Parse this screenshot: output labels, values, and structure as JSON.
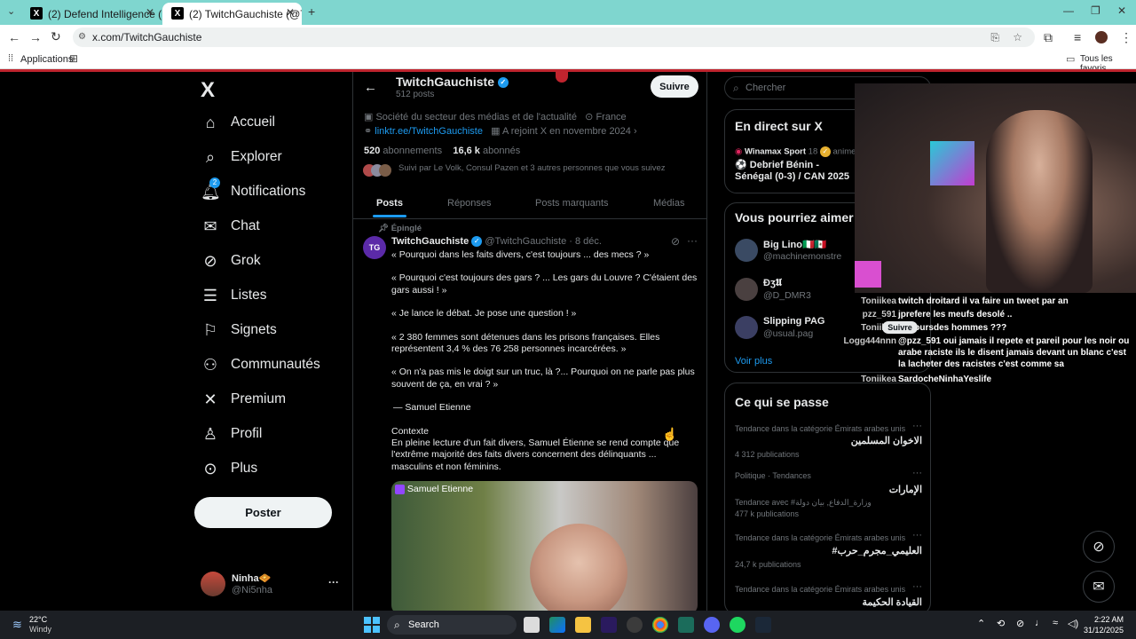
{
  "browser": {
    "tabs": [
      {
        "title": "(2) Defend Intelligence (Anis Ay",
        "favicon": "X"
      },
      {
        "title": "(2) TwitchGauchiste (@TwitchG",
        "favicon": "X"
      }
    ],
    "new_tab": "+",
    "url": "x.com/TwitchGauchiste",
    "bookmarks_apps": "Applications",
    "bookmarks_all": "Tous les favoris"
  },
  "nav": {
    "logo": "X",
    "items": [
      {
        "label": "Accueil",
        "icon": "home-icon"
      },
      {
        "label": "Explorer",
        "icon": "search-icon"
      },
      {
        "label": "Notifications",
        "icon": "bell-icon",
        "badge": "2"
      },
      {
        "label": "Chat",
        "icon": "mail-icon"
      },
      {
        "label": "Grok",
        "icon": "grok-icon"
      },
      {
        "label": "Listes",
        "icon": "list-icon"
      },
      {
        "label": "Signets",
        "icon": "bookmark-icon"
      },
      {
        "label": "Communautés",
        "icon": "people-icon"
      },
      {
        "label": "Premium",
        "icon": "x-icon"
      },
      {
        "label": "Profil",
        "icon": "user-icon"
      },
      {
        "label": "Plus",
        "icon": "more-icon"
      }
    ],
    "post_button": "Poster",
    "account": {
      "name": "Ninha🧇",
      "handle": "@Ni5nha",
      "more": "···"
    }
  },
  "profile": {
    "name": "TwitchGauchiste",
    "posts_count": "512 posts",
    "follow_button": "Suivre",
    "category": "Société du secteur des médias et de l'actualité",
    "location": "France",
    "link": "linktr.ee/TwitchGauchiste",
    "joined": "A rejoint X en novembre 2024",
    "following_count": "520",
    "following_label": "abonnements",
    "followers_count": "16,6 k",
    "followers_label": "abonnés",
    "followed_by": "Suivi par Le Volk, Consul Pazen et 3 autres personnes que vous suivez",
    "tabs": [
      "Posts",
      "Réponses",
      "Posts marquants",
      "Médias"
    ]
  },
  "post": {
    "pinned": "Épinglé",
    "author": "TwitchGauchiste",
    "handle": "@TwitchGauchiste",
    "date": "· 8 déc.",
    "avatar_text": "TG",
    "paragraphs": [
      "« Pourquoi dans les faits divers, c'est toujours ... des mecs ? »",
      "« Pourquoi c'est toujours des gars ? ... Les gars du Louvre ? C'étaient des gars aussi ! »",
      "« Je lance le débat. Je pose une question ! »",
      "« 2 380 femmes sont détenues dans les prisons françaises. Elles représentent 3,4 % des 76 258 personnes incarcérées. »",
      "« On n'a pas mis le doigt sur un truc, là ?... Pourquoi on ne parle pas plus souvent de ça, en vrai ? »",
      "— Samuel Etienne",
      "Contexte",
      "En pleine lecture d'un fait divers, Samuel Étienne se rend compte que l'extrême majorité des faits divers concernent des délinquants ... masculins et non féminins."
    ],
    "video_label": "Samuel Etienne"
  },
  "right": {
    "search_placeholder": "Chercher",
    "live": {
      "title": "En direct sur X",
      "host": "Winamax Sport",
      "host_suffix": "18",
      "host_action": "anime.",
      "event": "⚽ Debrief Bénin - Sénégal (0-3) / CAN 2025"
    },
    "suggest": {
      "title": "Vous pourriez aimer",
      "users": [
        {
          "name": "Big Lino🇮🇹🇲🇽",
          "handle": "@machinemonstre"
        },
        {
          "name": "Ɖʒ𝖀",
          "handle": "@D_DMR3"
        },
        {
          "name": "Slipping PAG",
          "handle": "@usual.pag"
        }
      ],
      "more": "Voir plus"
    },
    "trends": {
      "title": "Ce qui se passe",
      "items": [
        {
          "context": "Tendance dans la catégorie Émirats arabes unis",
          "name": "الاخوان المسلمين",
          "count": "4 312 publications"
        },
        {
          "context": "Politique · Tendances",
          "name": "الإمارات",
          "extra": "Tendance avec #وزارة_الدفاع, بيان دولة",
          "count": "477 k publications"
        },
        {
          "context": "Tendance dans la catégorie Émirats arabes unis",
          "name": "#العليمي_مجرم_حرب",
          "count": "24,7 k publications"
        },
        {
          "context": "Tendance dans la catégorie Émirats arabes unis",
          "name": "القيادة الحكيمة",
          "count": ""
        }
      ]
    }
  },
  "chat": [
    {
      "user": "Toniikea",
      "msg": "twitch droitard il va faire un tweet par an"
    },
    {
      "user": "pzz_591",
      "msg": "jprefere les meufs desolé .."
    },
    {
      "user": "Toniikea",
      "msg": "toujoursdes hommes ???"
    },
    {
      "user": "Logg444nnn",
      "msg": "@pzz_591 oui jamais il repete et pareil pour les noir ou arabe raciste ils le disent jamais devant un blanc c'est la lacheter des racistes c'est comme sa"
    },
    {
      "user": "Toniikea",
      "msg": "SardocheNinhaYeslife"
    }
  ],
  "chat_overlay_button": "Suivre",
  "taskbar": {
    "weather_temp": "22°C",
    "weather_label": "Windy",
    "search": "Search",
    "time": "2:22 AM",
    "date": "31/12/2025"
  }
}
